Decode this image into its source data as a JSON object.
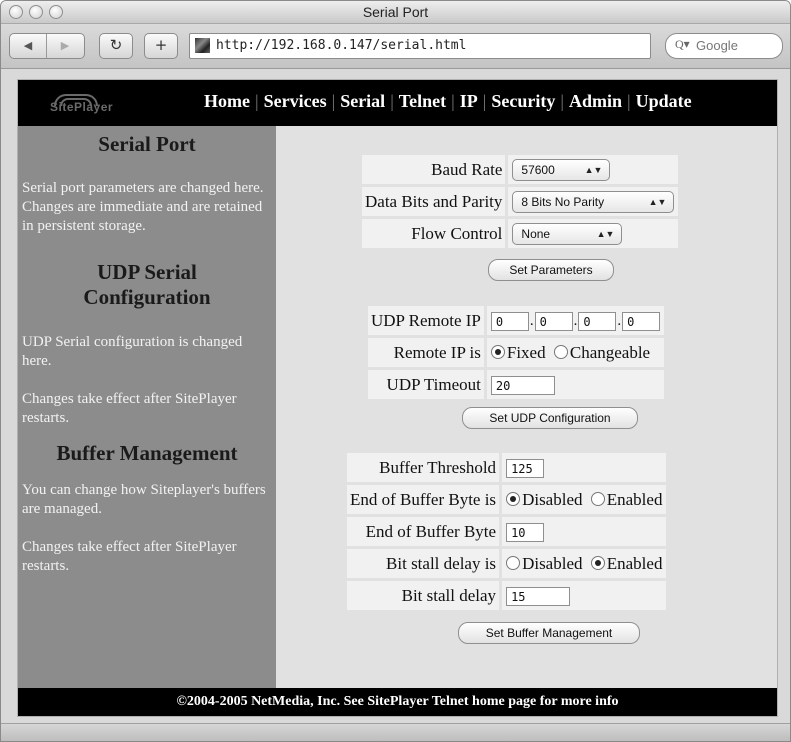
{
  "window": {
    "title": "Serial Port"
  },
  "toolbar": {
    "url": "http://192.168.0.147/serial.html",
    "search_placeholder": "Google",
    "back_icon": "back-arrow-icon",
    "forward_icon": "forward-arrow-icon",
    "reload_icon": "reload-icon",
    "add_icon": "plus-icon"
  },
  "logo": {
    "text": "SitePlayer"
  },
  "nav": {
    "items": [
      "Home",
      "Services",
      "Serial",
      "Telnet",
      "IP",
      "Security",
      "Admin",
      "Update"
    ]
  },
  "sidebar": {
    "serial_title": "Serial Port",
    "serial_text": "Serial port parameters are changed here. Changes are immediate and are retained in persistent storage.",
    "udp_title": "UDP Serial Configuration",
    "udp_text": "UDP Serial configuration is changed here.",
    "udp_note": "Changes take effect after SitePlayer restarts.",
    "buffer_title": "Buffer Management",
    "buffer_text": "You can change how Siteplayer's buffers are managed.",
    "buffer_note": "Changes take effect after SitePlayer restarts."
  },
  "serial": {
    "baud_label": "Baud Rate",
    "baud_value": "57600",
    "bits_label": "Data Bits and Parity",
    "bits_value": "8 Bits No Parity",
    "flow_label": "Flow Control",
    "flow_value": "None",
    "button": "Set Parameters"
  },
  "udp": {
    "remote_ip_label": "UDP Remote IP",
    "ip": [
      "0",
      "0",
      "0",
      "0"
    ],
    "ip_sep": ".",
    "remote_is_label": "Remote IP is",
    "fixed_label": "Fixed",
    "changeable_label": "Changeable",
    "timeout_label": "UDP Timeout",
    "timeout_value": "20",
    "button": "Set UDP Configuration"
  },
  "buffer": {
    "threshold_label": "Buffer Threshold",
    "threshold_value": "125",
    "eob_is_label": "End of Buffer Byte is",
    "disabled_label": "Disabled",
    "enabled_label": "Enabled",
    "eob_label": "End of Buffer Byte",
    "eob_value": "10",
    "stall_is_label": "Bit stall delay is",
    "stall_label": "Bit stall delay",
    "stall_value": "15",
    "button": "Set Buffer Management"
  },
  "footer": {
    "text": "©2004-2005 NetMedia, Inc. See SitePlayer Telnet home page for more info"
  }
}
